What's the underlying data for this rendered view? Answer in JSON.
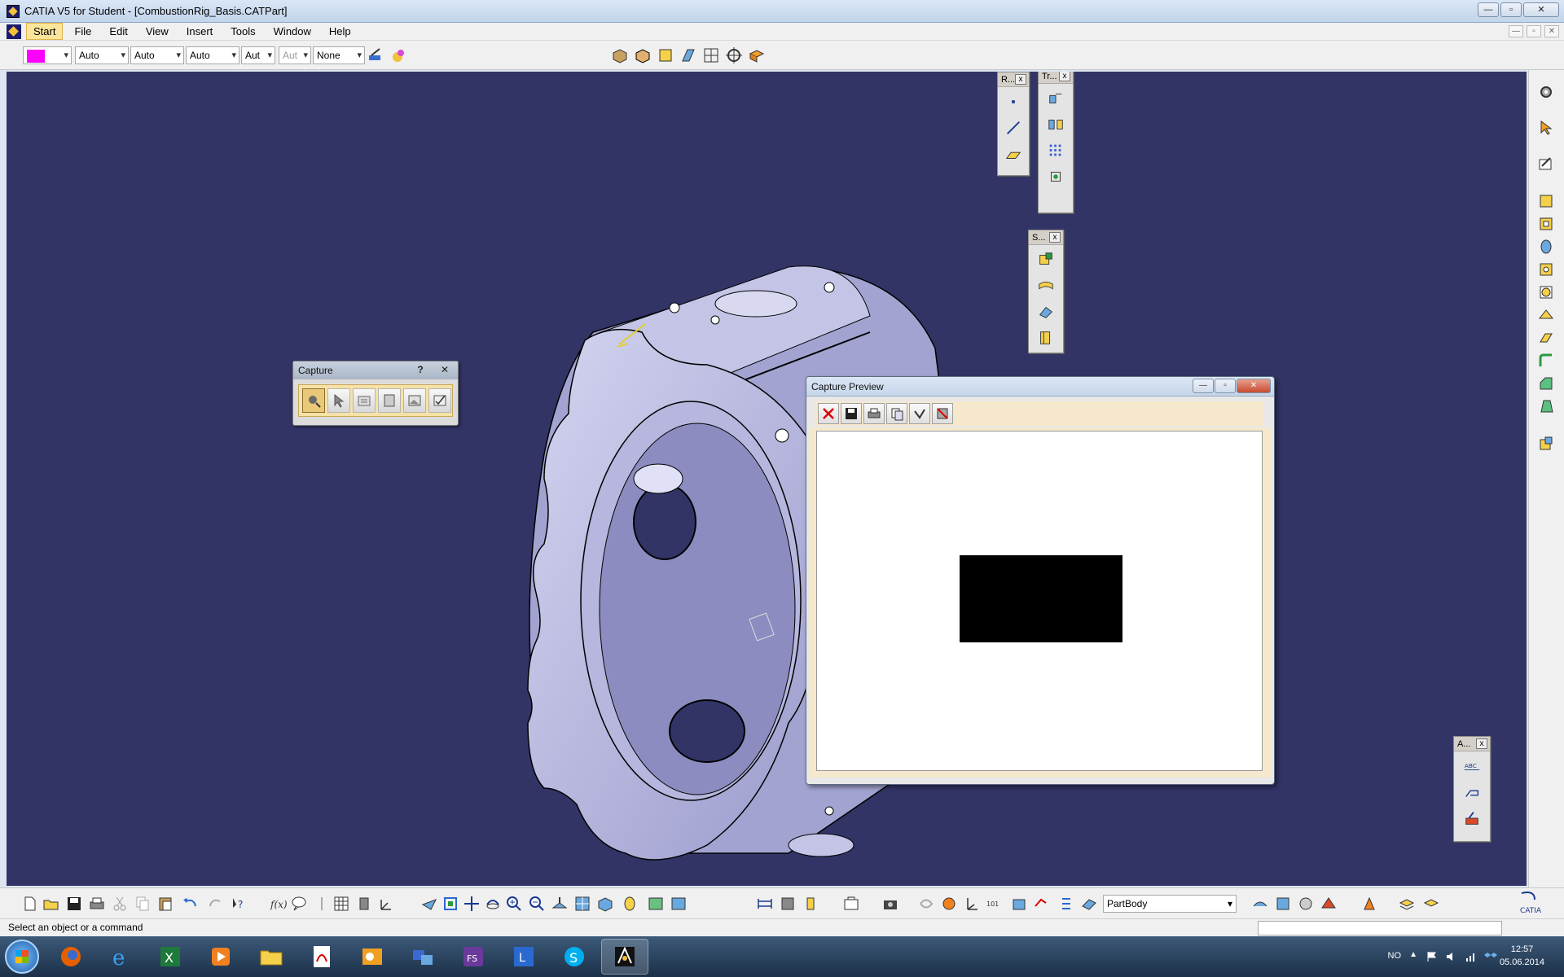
{
  "window": {
    "title": "CATIA V5 for Student - [CombustionRig_Basis.CATPart]",
    "controls": [
      "—",
      "▫",
      "✕"
    ]
  },
  "menu": {
    "items": [
      "Start",
      "File",
      "Edit",
      "View",
      "Insert",
      "Tools",
      "Window",
      "Help"
    ]
  },
  "properties_toolbar": {
    "color": "#ff00ff",
    "transparency": "Auto",
    "line_thickness": "Auto",
    "linetype": "Auto",
    "point_type": "Aut",
    "layer_disabled": "Aut",
    "rendering_style": "None"
  },
  "floating_toolbars": {
    "reference": {
      "title": "R...",
      "close": "x"
    },
    "transformations": {
      "title": "Tr...",
      "close": "x"
    },
    "surface": {
      "title": "S...",
      "close": "x"
    },
    "annotations": {
      "title": "A...",
      "close": "x"
    }
  },
  "capture_toolbar": {
    "title": "Capture",
    "help": "?",
    "close": "✕"
  },
  "capture_preview": {
    "title": "Capture Preview",
    "controls": [
      "—",
      "▫",
      "✕"
    ]
  },
  "bottom_toolbar": {
    "current_body": "PartBody"
  },
  "status_bar": {
    "message": "Select an object or a command"
  },
  "taskbar": {
    "language": "NO",
    "time": "12:57",
    "date": "05.06.2014"
  },
  "colors": {
    "viewport_background": "#323466",
    "part_color": "#b4b4de",
    "accent": "#fbe59a"
  }
}
